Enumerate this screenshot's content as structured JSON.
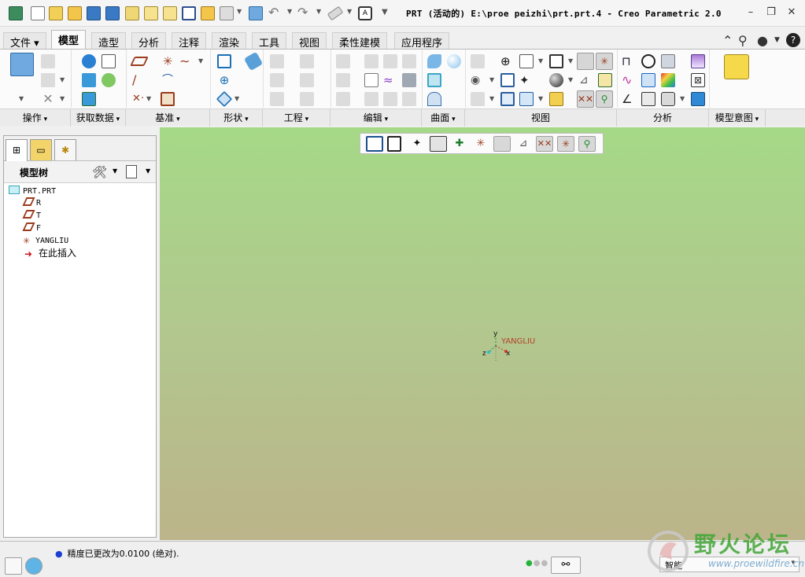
{
  "window": {
    "title": "PRT (活动的) E:\\proe peizhi\\prt.prt.4 - Creo Parametric 2.0",
    "buttons": [
      "minimize",
      "restore",
      "close"
    ]
  },
  "quick_access": {
    "icons": [
      "app-icon",
      "new-icon",
      "new-folder-icon",
      "open-icon",
      "save-icon",
      "save-all-icon",
      "copy-icon",
      "edit-icon",
      "checkmark-icon",
      "folder-icon",
      "window-icon",
      "regenerate-icon",
      "undo-icon",
      "redo-icon",
      "measure-icon",
      "text-icon"
    ]
  },
  "tabs": [
    {
      "label": "文件",
      "active": false
    },
    {
      "label": "模型",
      "active": true
    },
    {
      "label": "造型",
      "active": false
    },
    {
      "label": "分析",
      "active": false
    },
    {
      "label": "注释",
      "active": false
    },
    {
      "label": "渲染",
      "active": false
    },
    {
      "label": "工具",
      "active": false
    },
    {
      "label": "视图",
      "active": false
    },
    {
      "label": "柔性建模",
      "active": false
    },
    {
      "label": "应用程序",
      "active": false
    }
  ],
  "ribbon_groups": [
    {
      "label": "操作",
      "dropdown": true
    },
    {
      "label": "获取数据",
      "dropdown": true
    },
    {
      "label": "基准",
      "dropdown": true
    },
    {
      "label": "形状",
      "dropdown": true
    },
    {
      "label": "工程",
      "dropdown": true
    },
    {
      "label": "编辑",
      "dropdown": true
    },
    {
      "label": "曲面",
      "dropdown": true
    },
    {
      "label": "视图",
      "dropdown": false
    },
    {
      "label": "分析",
      "dropdown": false
    },
    {
      "label": "模型意图",
      "dropdown": true
    }
  ],
  "model_tree": {
    "title": "模型树",
    "items": [
      {
        "label": "PRT.PRT",
        "icon": "part-icon"
      },
      {
        "label": "R",
        "icon": "datum-plane-icon"
      },
      {
        "label": "T",
        "icon": "datum-plane-icon"
      },
      {
        "label": "F",
        "icon": "datum-plane-icon"
      },
      {
        "label": "YANGLIU",
        "icon": "coordinate-system-icon"
      },
      {
        "label": "在此插入",
        "icon": "insert-arrow-icon"
      }
    ]
  },
  "graphics": {
    "csys_label": "YANGLIU",
    "axis_y": "y",
    "axis_z": "z",
    "axis_x": "x",
    "background_top": "#a5d987",
    "background_bottom": "#bcb48a"
  },
  "status": {
    "message": "精度已更改为0.0100 (绝对).",
    "filter_value": "智能"
  },
  "watermark": {
    "title": "野火论坛",
    "url": "www.proewildfire.cn"
  }
}
